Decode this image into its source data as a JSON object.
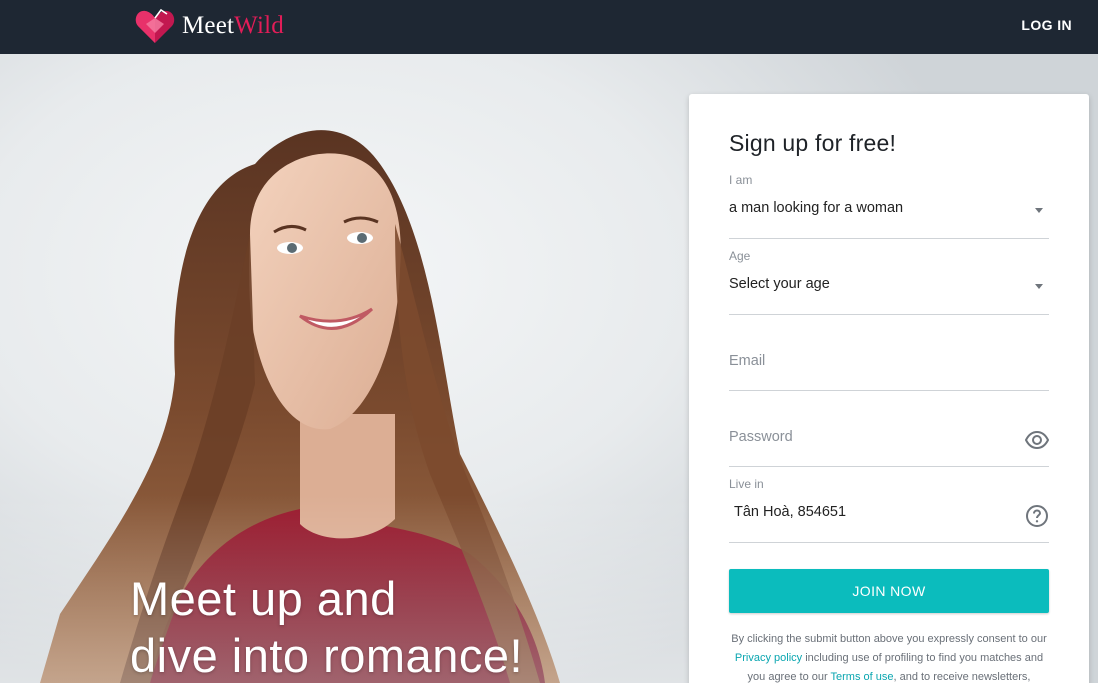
{
  "header": {
    "brand_first": "Meet",
    "brand_second": "Wild",
    "login_label": "LOG IN",
    "logo_icon": "heart-logo-icon"
  },
  "hero": {
    "headline_line1": "Meet up and",
    "headline_line2": "dive into romance!"
  },
  "signup": {
    "title": "Sign up for free!",
    "i_am": {
      "label": "I am",
      "value": "a man looking for a woman"
    },
    "age": {
      "label": "Age",
      "value": "Select your age"
    },
    "email": {
      "placeholder": "Email"
    },
    "password": {
      "placeholder": "Password"
    },
    "live_in": {
      "label": "Live in",
      "value": "Tân Hoà, 854651"
    },
    "join_label": "JOIN NOW",
    "legal": {
      "part1": "By clicking the submit button above you expressly consent to our",
      "privacy_link": "Privacy policy",
      "part2": "including use of profiling to find you matches and you agree to our",
      "terms_link": "Terms of use",
      "part3": ", and to receive newsletters,"
    }
  },
  "colors": {
    "header_bg": "#1e2733",
    "brand_accent": "#e11d58",
    "button_teal": "#0bbcbd",
    "link_teal": "#0aa6b0"
  }
}
